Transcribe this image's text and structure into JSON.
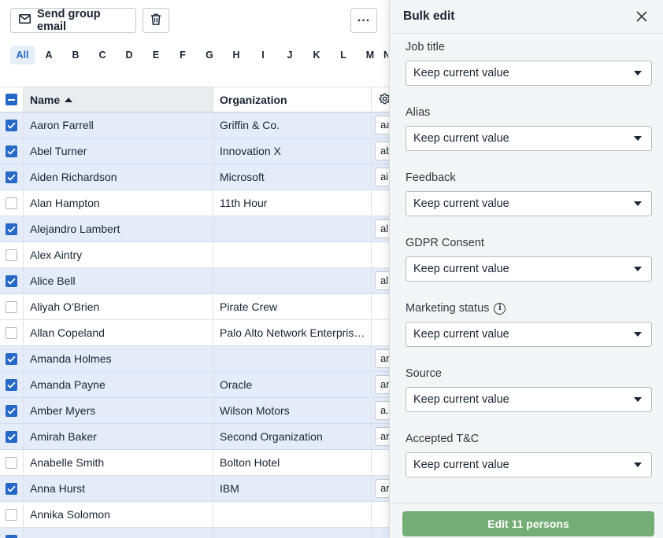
{
  "toolbar": {
    "send_email_label": "Send group email",
    "email_icon": "envelope-icon",
    "trash_icon": "trash-icon",
    "more_icon": "more-dots-icon"
  },
  "alphabet": [
    "All",
    "A",
    "B",
    "C",
    "D",
    "E",
    "F",
    "G",
    "H",
    "I",
    "J",
    "K",
    "L",
    "M",
    "N"
  ],
  "table": {
    "columns": {
      "name": "Name",
      "organization": "Organization"
    },
    "sort": "ascending",
    "settings_icon": "gear-icon",
    "rows": [
      {
        "name": "Aaron Farrell",
        "organization": "Griffin & Co.",
        "selected": true,
        "extra": "aa"
      },
      {
        "name": "Abel Turner",
        "organization": "Innovation X",
        "selected": true,
        "extra": "ab"
      },
      {
        "name": "Aiden Richardson",
        "organization": "Microsoft",
        "selected": true,
        "extra": "ai"
      },
      {
        "name": "Alan Hampton",
        "organization": "11th Hour",
        "selected": false,
        "extra": ""
      },
      {
        "name": "Alejandro Lambert",
        "organization": "",
        "selected": true,
        "extra": "al"
      },
      {
        "name": "Alex Aintry",
        "organization": "",
        "selected": false,
        "extra": ""
      },
      {
        "name": "Alice Bell",
        "organization": "",
        "selected": true,
        "extra": "al"
      },
      {
        "name": "Aliyah O'Brien",
        "organization": "Pirate Crew",
        "selected": false,
        "extra": ""
      },
      {
        "name": "Allan Copeland",
        "organization": "Palo Alto Network Enterprises",
        "selected": false,
        "extra": ""
      },
      {
        "name": "Amanda Holmes",
        "organization": "",
        "selected": true,
        "extra": "ar"
      },
      {
        "name": "Amanda Payne",
        "organization": "Oracle",
        "selected": true,
        "extra": "ar"
      },
      {
        "name": "Amber Myers",
        "organization": "Wilson Motors",
        "selected": true,
        "extra": "a."
      },
      {
        "name": "Amirah Baker",
        "organization": "Second Organization",
        "selected": true,
        "extra": "ar"
      },
      {
        "name": "Anabelle Smith",
        "organization": "Bolton Hotel",
        "selected": false,
        "extra": ""
      },
      {
        "name": "Anna Hurst",
        "organization": "IBM",
        "selected": true,
        "extra": "ar"
      },
      {
        "name": "Annika Solomon",
        "organization": "",
        "selected": false,
        "extra": ""
      },
      {
        "name": "",
        "organization": "",
        "selected": true,
        "extra": ""
      }
    ]
  },
  "panel": {
    "title": "Bulk edit",
    "close_icon": "close-icon",
    "fields": [
      {
        "label": "Job title",
        "value": "Keep current value",
        "info": false
      },
      {
        "label": "Alias",
        "value": "Keep current value",
        "info": false
      },
      {
        "label": "Feedback",
        "value": "Keep current value",
        "info": false
      },
      {
        "label": "GDPR Consent",
        "value": "Keep current value",
        "info": false
      },
      {
        "label": "Marketing status",
        "value": "Keep current value",
        "info": true
      },
      {
        "label": "Source",
        "value": "Keep current value",
        "info": false
      },
      {
        "label": "Accepted T&C",
        "value": "Keep current value",
        "info": false
      }
    ],
    "submit_label": "Edit 11 persons",
    "colors": {
      "submit_bg": "#74ad76",
      "selection": "#2668c5",
      "selected_row": "#e4ecfa"
    }
  }
}
